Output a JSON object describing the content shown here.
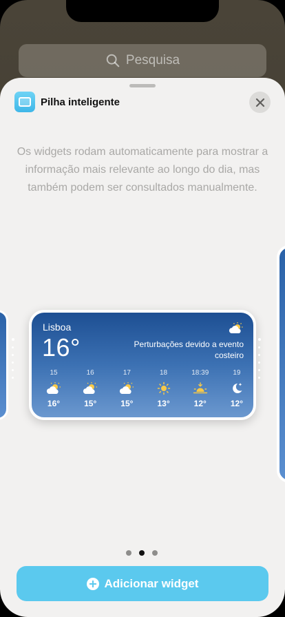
{
  "search": {
    "placeholder": "Pesquisa"
  },
  "sheet": {
    "title": "Pilha inteligente",
    "description": "Os widgets rodam automaticamente para mostrar a informação mais relevante ao longo do dia, mas também podem ser consultados manualmente."
  },
  "weather": {
    "city": "Lisboa",
    "temperature": "16°",
    "condition": "Perturbações devido a evento costeiro",
    "condition_icon": "partly-cloudy-icon",
    "forecast": [
      {
        "hour": "15",
        "icon": "partly-cloudy-icon",
        "temp": "16°"
      },
      {
        "hour": "16",
        "icon": "partly-cloudy-icon",
        "temp": "15°"
      },
      {
        "hour": "17",
        "icon": "partly-cloudy-icon",
        "temp": "15°"
      },
      {
        "hour": "18",
        "icon": "sun-icon",
        "temp": "13°"
      },
      {
        "hour": "18:39",
        "icon": "sunset-icon",
        "temp": "12°"
      },
      {
        "hour": "19",
        "icon": "moon-star-icon",
        "temp": "12°"
      }
    ]
  },
  "pagination": {
    "total": 3,
    "current": 2
  },
  "add_button": {
    "label": "Adicionar widget"
  },
  "colors": {
    "accent": "#5bc9ee",
    "widget_top": "#1d4f93",
    "widget_bottom": "#6b98cf"
  }
}
